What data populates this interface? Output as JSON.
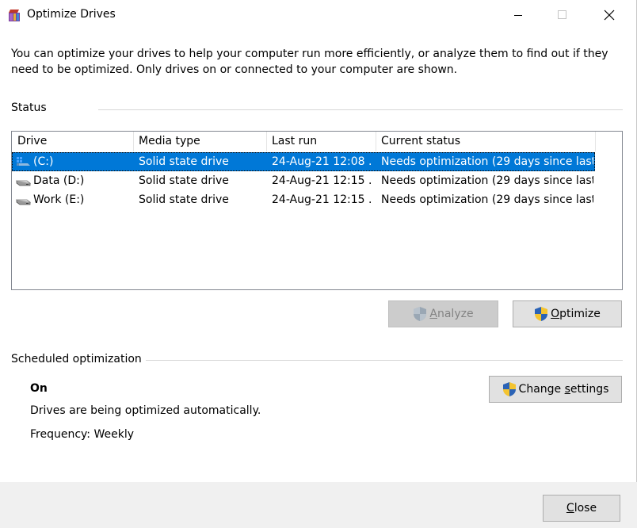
{
  "window": {
    "title": "Optimize Drives"
  },
  "intro": "You can optimize your drives to help your computer run more efficiently, or analyze them to find out if they need to be optimized. Only drives on or connected to your computer are shown.",
  "status_section": {
    "label": "Status"
  },
  "columns": [
    "Drive",
    "Media type",
    "Last run",
    "Current status"
  ],
  "drives": [
    {
      "drive": "(C:)",
      "media_type": "Solid state drive",
      "last_run": "24-Aug-21 12:08 ...",
      "status": "Needs optimization (29 days since last...",
      "icon": "windows-drive-icon",
      "selected": true
    },
    {
      "drive": "Data (D:)",
      "media_type": "Solid state drive",
      "last_run": "24-Aug-21 12:15 ...",
      "status": "Needs optimization (29 days since last...",
      "icon": "drive-icon",
      "selected": false
    },
    {
      "drive": "Work (E:)",
      "media_type": "Solid state drive",
      "last_run": "24-Aug-21 12:15 ...",
      "status": "Needs optimization (29 days since last...",
      "icon": "drive-icon",
      "selected": false
    }
  ],
  "buttons": {
    "analyze": {
      "label_first": "A",
      "label_rest": "nalyze",
      "enabled": false
    },
    "optimize": {
      "label_first": "O",
      "label_rest": "ptimize",
      "enabled": true
    },
    "change_settings": {
      "label_pre": "Change ",
      "label_first": "s",
      "label_rest": "ettings"
    },
    "close": {
      "label_first": "C",
      "label_rest": "lose"
    }
  },
  "schedule": {
    "label": "Scheduled optimization",
    "state": "On",
    "description": "Drives are being optimized automatically.",
    "frequency": "Frequency: Weekly"
  },
  "colors": {
    "selection": "#0078d7",
    "footer": "#f0f0f0"
  }
}
